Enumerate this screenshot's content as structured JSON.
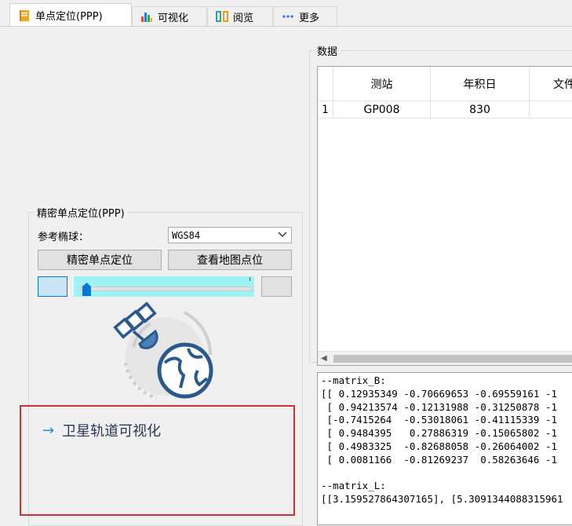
{
  "tabs": [
    {
      "label": "单点定位(PPP)",
      "icon": "notebook-icon"
    },
    {
      "label": "可视化",
      "icon": "bar-chart-icon"
    },
    {
      "label": "阅览",
      "icon": "reading-icon"
    },
    {
      "label": "更多",
      "icon": "more-dots-icon"
    }
  ],
  "data_group": {
    "title": "数据"
  },
  "table": {
    "columns": [
      "测站",
      "年积日",
      "文件"
    ],
    "rows": [
      {
        "index": "1",
        "cells": [
          "GP008",
          "830",
          ""
        ]
      }
    ]
  },
  "ppp_group": {
    "title": "精密单点定位(PPP)",
    "ellipsoid_label": "参考椭球：",
    "ellipsoid_value": "WGS84",
    "ppp_button": "精密单点定位",
    "map_button": "查看地图点位"
  },
  "slider": {
    "value_fraction": 0.02
  },
  "visualize_link": {
    "arrow": "→",
    "label": "卫星轨道可视化"
  },
  "console": {
    "lines": [
      "--matrix_B:",
      "[[ 0.12935349 -0.70669653 -0.69559161 -1",
      " [ 0.94213574 -0.12131988 -0.31250878 -1",
      " [-0.7415264  -0.53018061 -0.41115339 -1",
      " [ 0.9484395   0.27886319 -0.15065802 -1",
      " [ 0.4983325  -0.82688058 -0.26064002 -1",
      " [ 0.0081166  -0.81269237  0.58263646 -1",
      "",
      "--matrix_L:",
      "[[3.159527864307165], [5.3091344088315961"
    ]
  },
  "colors": {
    "accent": "#1e90d6",
    "highlight_border": "#d03030",
    "slider_fill": "#9ef3f6",
    "icon_blue": "#2a5a8c"
  }
}
